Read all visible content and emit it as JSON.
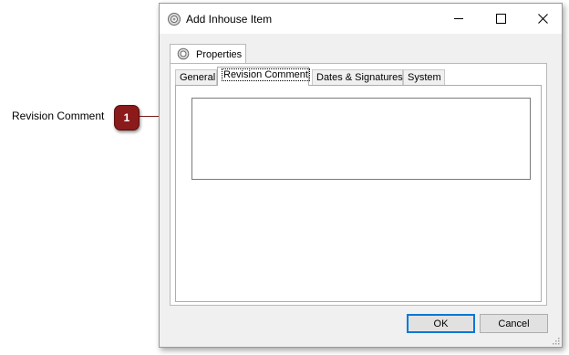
{
  "annotation": {
    "label": "Revision Comment",
    "badge_number": "1",
    "badge_color": "#8b1a1a"
  },
  "window": {
    "title": "Add Inhouse Item",
    "title_icon": "gear-icon",
    "controls": [
      "minimize-icon",
      "maximize-icon",
      "close-icon"
    ]
  },
  "outer_tab": {
    "label": "Properties",
    "icon": "gear-icon"
  },
  "tabs": [
    {
      "label": "General",
      "active": false
    },
    {
      "label": "Revision Comment",
      "active": true
    },
    {
      "label": "Dates & Signatures",
      "active": false
    },
    {
      "label": "System",
      "active": false
    }
  ],
  "revision_comment": {
    "value": ""
  },
  "buttons": {
    "ok": "OK",
    "cancel": "Cancel"
  },
  "colors": {
    "accent": "#0078d7",
    "dialog_bg": "#f0f0f0"
  }
}
